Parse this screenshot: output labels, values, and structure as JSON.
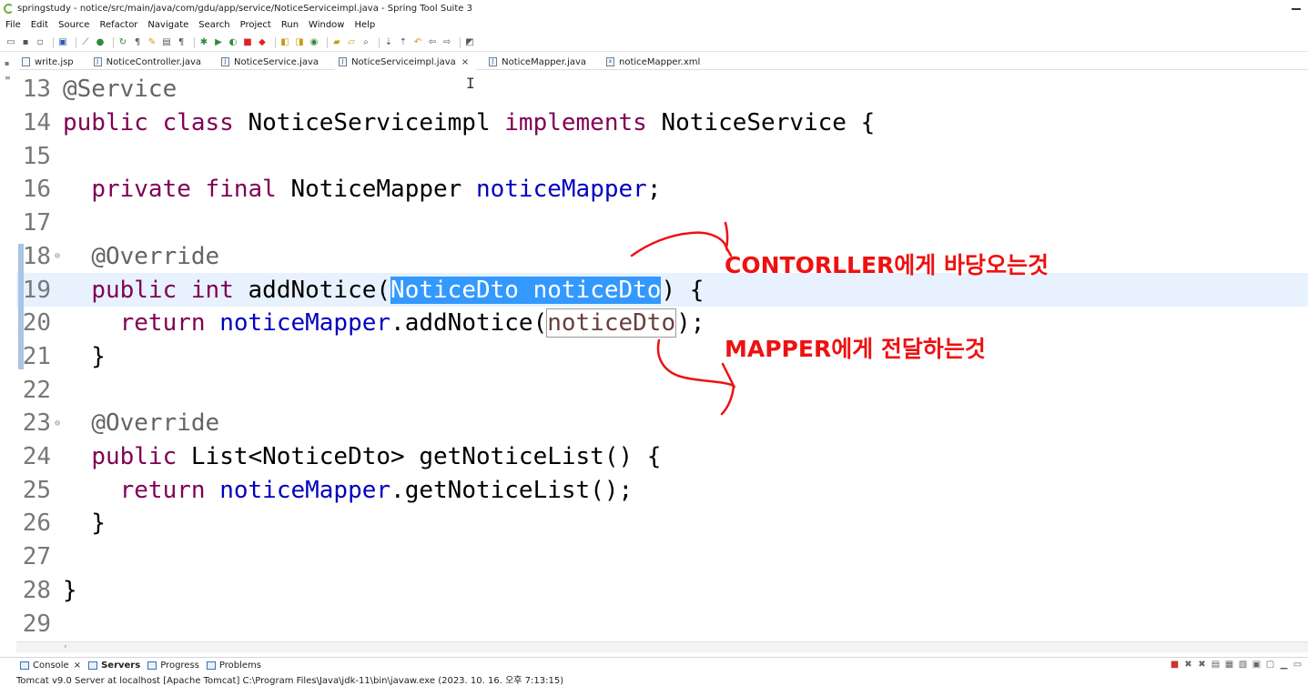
{
  "window": {
    "title": "springstudy - notice/src/main/java/com/gdu/app/service/NoticeServiceimpl.java - Spring Tool Suite 3"
  },
  "menu": [
    "File",
    "Edit",
    "Source",
    "Refactor",
    "Navigate",
    "Search",
    "Project",
    "Run",
    "Window",
    "Help"
  ],
  "tabs": [
    {
      "label": "write.jsp",
      "icon": "jsp-file-icon"
    },
    {
      "label": "NoticeController.java",
      "icon": "java-file-icon"
    },
    {
      "label": "NoticeService.java",
      "icon": "java-file-icon"
    },
    {
      "label": "NoticeServiceimpl.java",
      "icon": "java-file-icon",
      "active": true,
      "close": "×"
    },
    {
      "label": "NoticeMapper.java",
      "icon": "java-file-icon"
    },
    {
      "label": "noticeMapper.xml",
      "icon": "xml-file-icon"
    }
  ],
  "code": {
    "lines": [
      {
        "n": "13",
        "tokens": [
          {
            "t": "@Service",
            "c": "ann"
          }
        ]
      },
      {
        "n": "14",
        "tokens": [
          {
            "t": "public class",
            "c": "kw"
          },
          {
            "t": " NoticeServiceimpl ",
            "c": ""
          },
          {
            "t": "implements",
            "c": "kw"
          },
          {
            "t": " NoticeService {",
            "c": ""
          }
        ]
      },
      {
        "n": "15",
        "tokens": []
      },
      {
        "n": "16",
        "tokens": [
          {
            "t": "  ",
            "c": ""
          },
          {
            "t": "private final",
            "c": "kw"
          },
          {
            "t": " NoticeMapper ",
            "c": ""
          },
          {
            "t": "noticeMapper",
            "c": "fld"
          },
          {
            "t": ";",
            "c": ""
          }
        ]
      },
      {
        "n": "17",
        "tokens": []
      },
      {
        "n": "18",
        "tokens": [
          {
            "t": "  ",
            "c": ""
          },
          {
            "t": "@Override",
            "c": "ann"
          }
        ]
      },
      {
        "n": "19",
        "tokens": [
          {
            "t": "  ",
            "c": ""
          },
          {
            "t": "public int",
            "c": "kw"
          },
          {
            "t": " addNotice(",
            "c": ""
          },
          {
            "t": "NoticeDto noticeDto",
            "c": "sel"
          },
          {
            "t": ") {",
            "c": ""
          }
        ]
      },
      {
        "n": "20",
        "tokens": [
          {
            "t": "    ",
            "c": ""
          },
          {
            "t": "return",
            "c": "kw"
          },
          {
            "t": " ",
            "c": ""
          },
          {
            "t": "noticeMapper",
            "c": "fld"
          },
          {
            "t": ".addNotice(",
            "c": ""
          },
          {
            "t": "noticeDto",
            "c": "box"
          },
          {
            "t": ");",
            "c": ""
          }
        ]
      },
      {
        "n": "21",
        "tokens": [
          {
            "t": "  }",
            "c": ""
          }
        ]
      },
      {
        "n": "22",
        "tokens": []
      },
      {
        "n": "23",
        "tokens": [
          {
            "t": "  ",
            "c": ""
          },
          {
            "t": "@Override",
            "c": "ann"
          }
        ]
      },
      {
        "n": "24",
        "tokens": [
          {
            "t": "  ",
            "c": ""
          },
          {
            "t": "public",
            "c": "kw"
          },
          {
            "t": " List<NoticeDto> getNoticeList() {",
            "c": ""
          }
        ]
      },
      {
        "n": "25",
        "tokens": [
          {
            "t": "    ",
            "c": ""
          },
          {
            "t": "return",
            "c": "kw"
          },
          {
            "t": " ",
            "c": ""
          },
          {
            "t": "noticeMapper",
            "c": "fld"
          },
          {
            "t": ".getNoticeList();",
            "c": ""
          }
        ]
      },
      {
        "n": "26",
        "tokens": [
          {
            "t": "  }",
            "c": ""
          }
        ]
      },
      {
        "n": "27",
        "tokens": []
      },
      {
        "n": "28",
        "tokens": [
          {
            "t": "}",
            "c": ""
          }
        ]
      },
      {
        "n": "29",
        "tokens": []
      }
    ]
  },
  "annotations": {
    "controller_note": "CONTORLLER에게 바당오는것",
    "mapper_note": "MAPPER에게 전달하는것",
    "color": "#ee1111"
  },
  "bottom": {
    "tabs": [
      {
        "label": "Console",
        "close": "×"
      },
      {
        "label": "Servers",
        "bold": true
      },
      {
        "label": "Progress"
      },
      {
        "label": "Problems"
      }
    ],
    "status": "Tomcat v9.0 Server at localhost [Apache Tomcat] C:\\Program Files\\Java\\jdk-11\\bin\\javaw.exe  (2023. 10. 16. 오후 7:13:15)"
  },
  "colors": {
    "keyword": "#7f0055",
    "field": "#0000c0",
    "annotation": "#646464",
    "selection": "#3399ff",
    "current_line": "#e8f2fe"
  }
}
